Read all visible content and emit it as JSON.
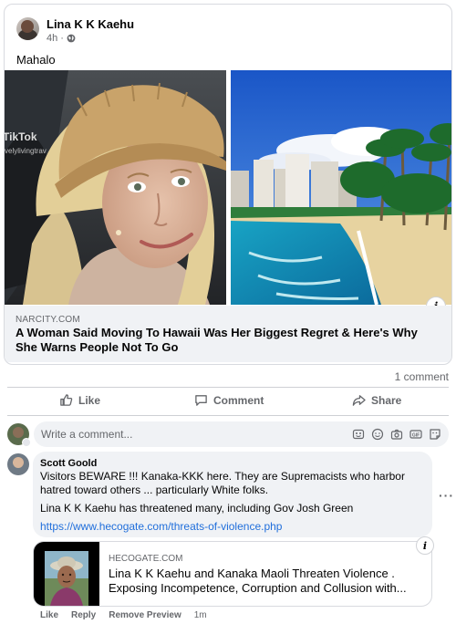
{
  "post": {
    "author": "Lina K K Kaehu",
    "time": "4h",
    "separator": "·",
    "caption": "Mahalo",
    "watermark": "TikTok",
    "watermark_sub": "velylivingtrav",
    "link": {
      "domain": "NARCITY.COM",
      "title": "A Woman Said Moving To Hawaii Was Her Biggest Regret & Here's Why She Warns People Not To Go"
    }
  },
  "stats": {
    "comments": "1 comment"
  },
  "actions": {
    "like": "Like",
    "comment": "Comment",
    "share": "Share"
  },
  "composer": {
    "placeholder": "Write a comment..."
  },
  "comment": {
    "author": "Scott Goold",
    "text1": "Visitors BEWARE !!! Kanaka-KKK here. They are Supremacists who harbor hatred toward others ... particularly White folks.",
    "text2": "Lina K K Kaehu has threatened many, including Gov Josh Green",
    "link": "https://www.hecogate.com/threats-of-violence.php",
    "preview": {
      "domain": "HECOGATE.COM",
      "title": "Lina K K Kaehu and Kanaka Maoli Threaten Violence . Exposing Incompetence, Corruption and Collusion with..."
    },
    "actions": {
      "like": "Like",
      "reply": "Reply",
      "remove_preview": "Remove Preview",
      "time": "1m"
    }
  },
  "icons": [
    "globe-icon",
    "info-icon",
    "like-icon",
    "comment-icon",
    "share-icon",
    "sticker-icon",
    "emoji-icon",
    "camera-icon",
    "gif-icon",
    "avatar-sticker-icon",
    "more-options-icon"
  ],
  "colors": {
    "link": "#216fdb",
    "muted_text": "#65676b",
    "bubble_bg": "#f0f2f5",
    "divider": "#ced0d4"
  }
}
